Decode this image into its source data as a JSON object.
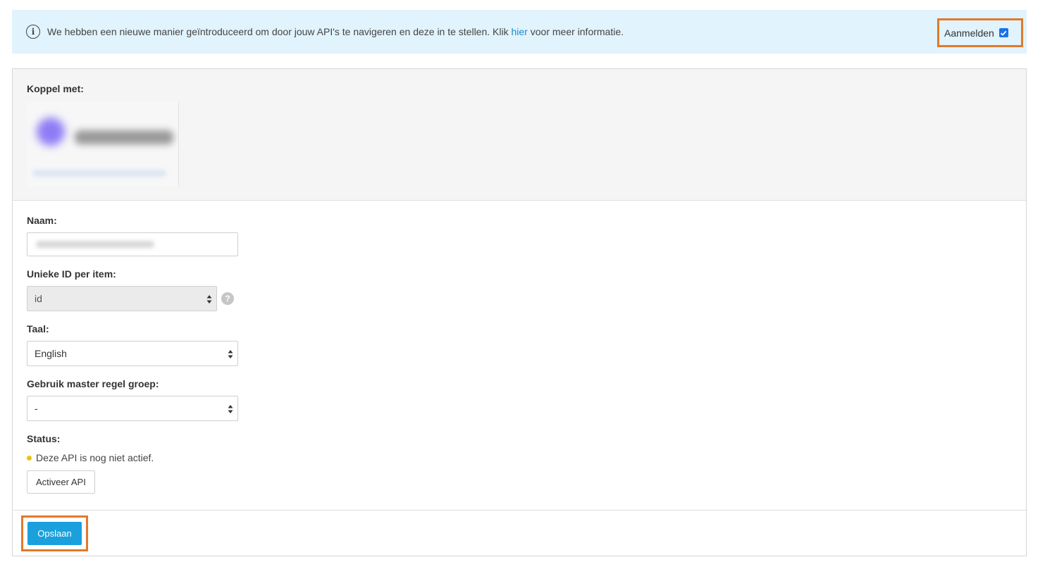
{
  "banner": {
    "message_before": "We hebben een nieuwe manier geïntroduceerd om door jouw API's te navigeren en deze in te stellen. Klik ",
    "link": "hier",
    "message_after": " voor meer informatie.",
    "optin_label": "Aanmelden",
    "optin_checked": true,
    "info_icon": "info-circle-icon"
  },
  "connect": {
    "label": "Koppel met:"
  },
  "form": {
    "name_label": "Naam:",
    "unique_id_label": "Unieke ID per item:",
    "unique_id_value": "id",
    "language_label": "Taal:",
    "language_value": "English",
    "master_rule_label": "Gebruik master regel groep:",
    "master_rule_value": "-",
    "status_label": "Status:",
    "status_text": "Deze API is nog niet actief.",
    "status_color": "#e8c515",
    "activate_label": "Activeer API"
  },
  "footer": {
    "save_label": "Opslaan"
  },
  "colors": {
    "accent": "#1aa0dc",
    "banner_bg": "#e1f3fc",
    "highlight": "#e07a2a",
    "link": "#1a8bcc"
  }
}
